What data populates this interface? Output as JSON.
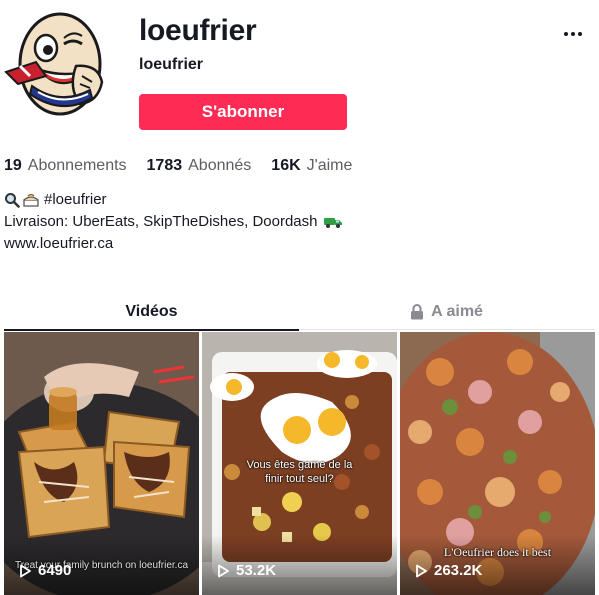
{
  "profile": {
    "username": "loeufrier",
    "nickname": "loeufrier",
    "follow_label": "S'abonner"
  },
  "stats": [
    {
      "value": "19",
      "label": "Abonnements"
    },
    {
      "value": "1783",
      "label": "Abonnés"
    },
    {
      "value": "16K",
      "label": "J'aime"
    }
  ],
  "bio": {
    "hashtag": "#loeufrier",
    "delivery": "Livraison: UberEats, SkipTheDishes, Doordash",
    "website": "www.loeufrier.ca"
  },
  "tabs": [
    {
      "label": "Vidéos",
      "active": true
    },
    {
      "label": "A aimé",
      "active": false,
      "icon": "lock-icon"
    }
  ],
  "videos": [
    {
      "views": "6490",
      "caption": "Treat your family brunch on loeufrier.ca",
      "thumb": "waffles-chocolate"
    },
    {
      "views": "53.2K",
      "caption": "Vous êtes game de la finir tout seul?",
      "thumb": "eggs-poutine"
    },
    {
      "views": "263.2K",
      "caption": "L'Oeufrier does it best",
      "thumb": "hash-skillet"
    }
  ],
  "colors": {
    "accent": "#fe2c55",
    "text": "#161823",
    "secondary": "#5c5d65"
  }
}
